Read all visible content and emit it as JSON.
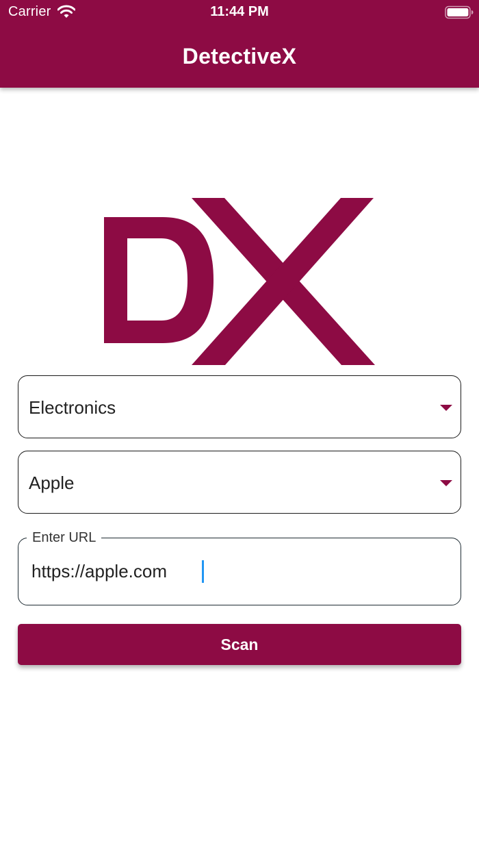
{
  "status_bar": {
    "carrier": "Carrier",
    "time": "11:44 PM",
    "wifi_icon": "wifi-icon",
    "battery_icon": "battery-full-icon"
  },
  "app_bar": {
    "title": "DetectiveX"
  },
  "logo": {
    "text": "DX",
    "color": "#8d0b44"
  },
  "form": {
    "category_select": {
      "selected": "Electronics",
      "icon": "caret-down-icon"
    },
    "brand_select": {
      "selected": "Apple",
      "icon": "caret-down-icon"
    },
    "url_field": {
      "label": "Enter URL",
      "value": "https://apple.com"
    },
    "scan_button": {
      "label": "Scan"
    }
  },
  "colors": {
    "primary": "#8d0b44",
    "cursor": "#2196f3",
    "background": "#ffffff"
  }
}
